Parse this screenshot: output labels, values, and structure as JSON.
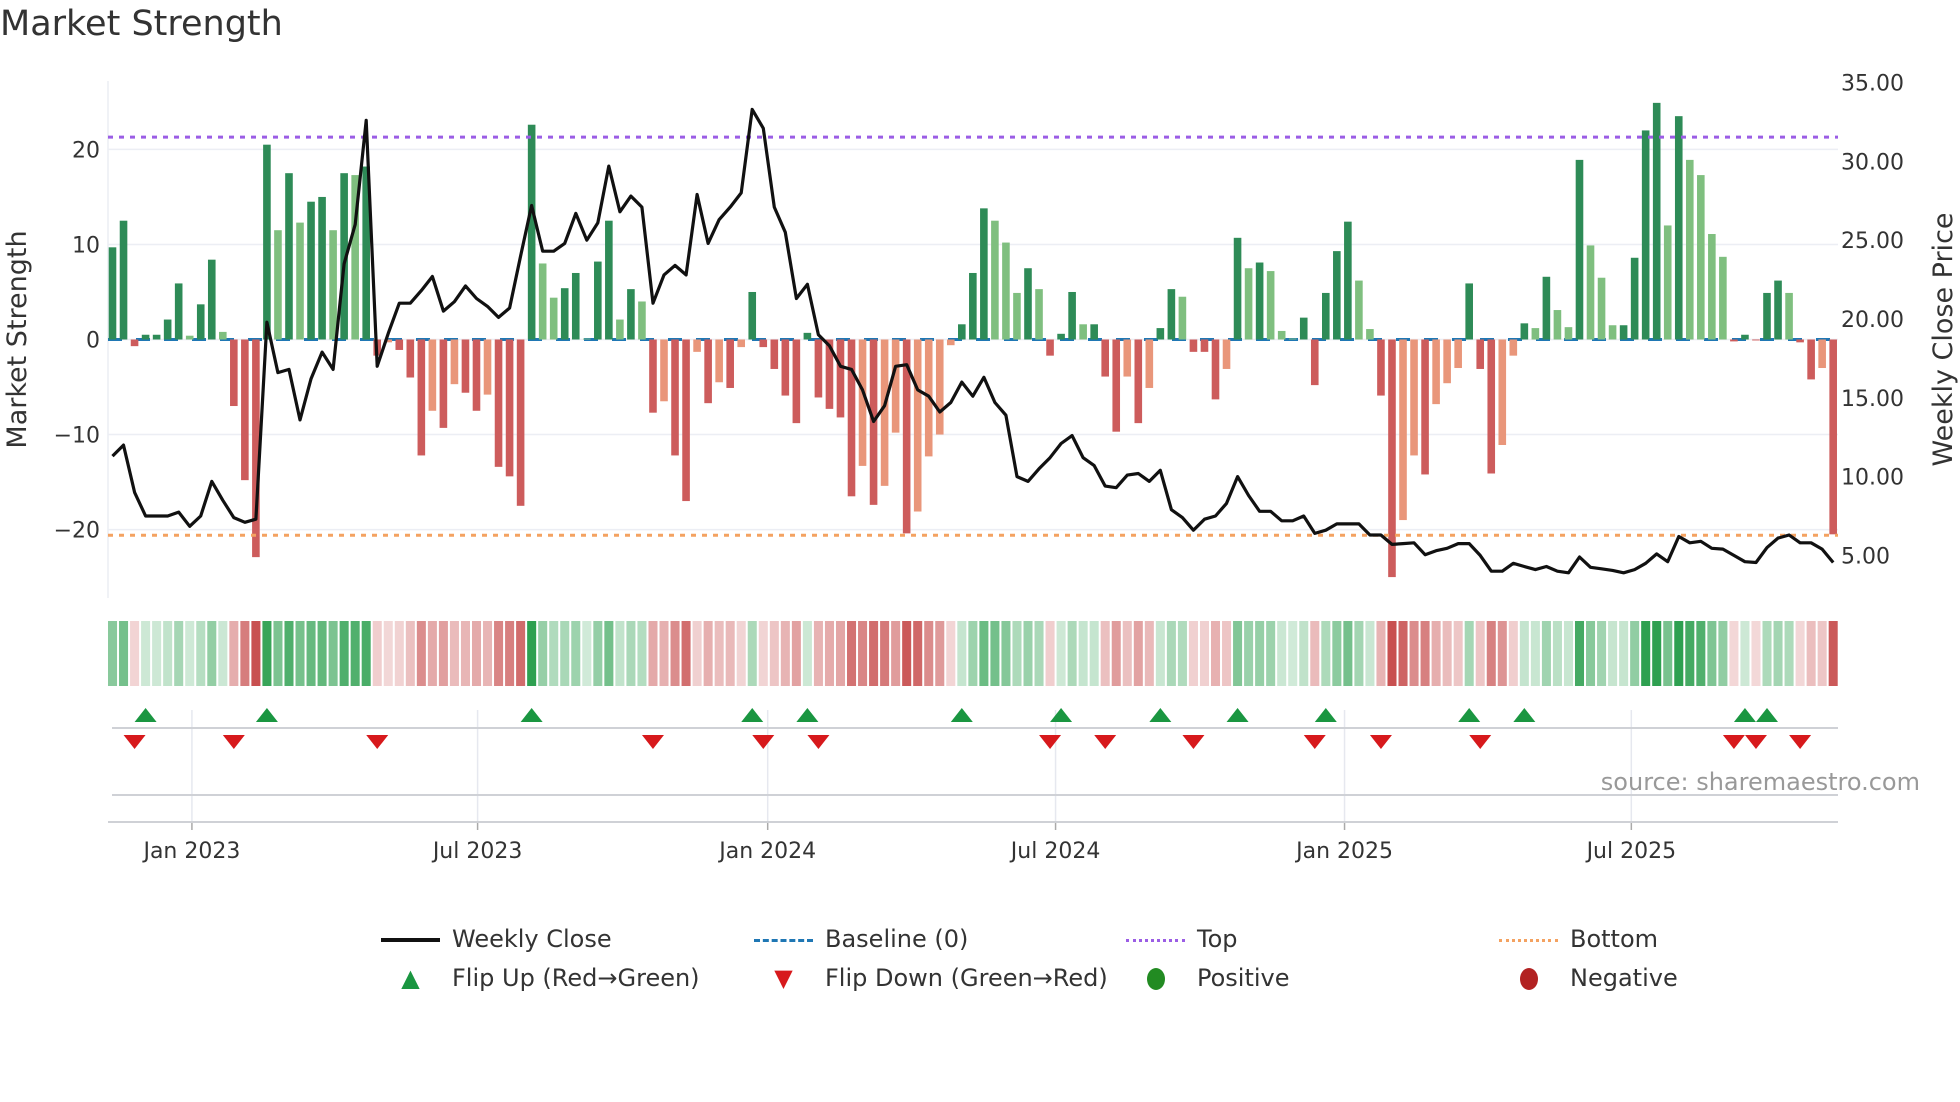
{
  "title": "Market Strength",
  "source": "source: sharemaestro.com",
  "colors": {
    "dark_green": "#2e8b57",
    "light_green": "#7fbf7f",
    "dark_red": "#cd5c5c",
    "light_red": "#e9967a",
    "baseline": "#1f77b4",
    "top": "#9b5de5",
    "bottom": "#f4a261",
    "flip_up": "#1a9641",
    "flip_down": "#d7191c",
    "positive": "#228b22",
    "negative": "#b22222",
    "price": "#111111"
  },
  "legend": [
    {
      "label": "Weekly Close",
      "icon": "solid-line"
    },
    {
      "label": "Baseline (0)",
      "icon": "dashed-line"
    },
    {
      "label": "Top",
      "icon": "dotted-line"
    },
    {
      "label": "Bottom",
      "icon": "dotted-line"
    },
    {
      "label": "Flip Up (Red→Green)",
      "icon": "triangle-up"
    },
    {
      "label": "Flip Down (Green→Red)",
      "icon": "triangle-down"
    },
    {
      "label": "Positive",
      "icon": "circle"
    },
    {
      "label": "Negative",
      "icon": "circle"
    }
  ],
  "chart_data": {
    "type": "bar",
    "title": "Market Strength",
    "ylabel": "Market Strength",
    "y2label": "Weekly Close Price",
    "ylim": [
      -27.2,
      27.2
    ],
    "y2lim": [
      2.3,
      35.1
    ],
    "yticks": [
      20,
      10,
      0,
      -10,
      -20
    ],
    "ytick_labels": [
      "20",
      "10",
      "0",
      "−10",
      "−20"
    ],
    "y2ticks": [
      35,
      30,
      25,
      20,
      15,
      10,
      5
    ],
    "y2tick_labels": [
      "35.00",
      "30.00",
      "25.00",
      "20.00",
      "15.00",
      "10.00",
      "5.00"
    ],
    "xticks": [
      {
        "label": "Jan 2023",
        "week": 7.2
      },
      {
        "label": "Jul 2023",
        "week": 33.1
      },
      {
        "label": "Jan 2024",
        "week": 59.4
      },
      {
        "label": "Jul 2024",
        "week": 85.5
      },
      {
        "label": "Jan 2025",
        "week": 111.7
      },
      {
        "label": "Jul 2025",
        "week": 137.7
      }
    ],
    "top_level": 21.3,
    "bottom_level": -20.6,
    "strength": [
      9.7,
      12.5,
      -0.7,
      0.5,
      0.5,
      2.1,
      5.9,
      0.4,
      3.7,
      8.4,
      0.8,
      -7.0,
      -14.8,
      -22.9,
      20.5,
      11.5,
      17.5,
      12.3,
      14.5,
      15.0,
      11.5,
      17.5,
      17.3,
      18.2,
      -1.7,
      -0.3,
      -1.1,
      -4.0,
      -12.2,
      -7.5,
      -9.3,
      -4.7,
      -5.6,
      -7.5,
      -5.8,
      -13.4,
      -14.4,
      -17.5,
      22.6,
      8.0,
      4.4,
      5.4,
      7.0,
      0.1,
      8.2,
      12.5,
      2.1,
      5.3,
      4.0,
      -7.7,
      -6.5,
      -12.2,
      -17.0,
      -1.3,
      -6.7,
      -4.5,
      -5.1,
      -0.8,
      5.0,
      -0.8,
      -3.1,
      -5.9,
      -8.8,
      0.7,
      -6.1,
      -7.3,
      -8.2,
      -16.5,
      -13.3,
      -17.4,
      -15.4,
      -9.8,
      -20.4,
      -18.1,
      -12.3,
      -10.0,
      -0.6,
      1.6,
      7.0,
      13.8,
      12.5,
      10.2,
      4.9,
      7.5,
      5.3,
      -1.7,
      0.6,
      5.0,
      1.6,
      1.6,
      -3.9,
      -9.7,
      -3.9,
      -8.8,
      -5.1,
      1.2,
      5.3,
      4.5,
      -1.3,
      -1.3,
      -6.3,
      -3.1,
      10.7,
      7.5,
      8.1,
      7.2,
      0.9,
      0.1,
      2.3,
      -4.8,
      4.9,
      9.3,
      12.4,
      6.2,
      1.1,
      -5.9,
      -25.0,
      -19.0,
      -12.2,
      -14.2,
      -6.8,
      -4.6,
      -3.0,
      5.9,
      -3.1,
      -14.1,
      -11.1,
      -1.7,
      1.7,
      1.2,
      6.6,
      3.1,
      1.3,
      18.9,
      9.9,
      6.5,
      1.5,
      1.5,
      8.6,
      22.0,
      24.9,
      12.0,
      23.5,
      18.9,
      17.3,
      11.1,
      8.7,
      -0.2,
      0.5,
      -0.1,
      4.9,
      6.2,
      4.9,
      -0.3,
      -4.2,
      -3.0,
      -20.5
    ],
    "weekly_close": [
      11.3,
      12.0,
      9.0,
      7.5,
      7.5,
      7.5,
      7.75,
      6.85,
      7.5,
      9.7,
      8.5,
      7.4,
      7.1,
      7.3,
      19.8,
      16.6,
      16.8,
      13.6,
      16.2,
      17.9,
      16.8,
      23.5,
      26.0,
      32.6,
      17.0,
      19.1,
      21.0,
      21.0,
      21.8,
      22.7,
      20.5,
      21.1,
      22.1,
      21.3,
      20.8,
      20.1,
      20.7,
      24.0,
      27.2,
      24.3,
      24.3,
      24.8,
      26.7,
      25.0,
      26.1,
      29.7,
      26.8,
      27.8,
      27.1,
      21.0,
      22.8,
      23.4,
      22.8,
      27.9,
      24.8,
      26.3,
      27.1,
      28.0,
      33.3,
      32.1,
      27.1,
      25.5,
      21.3,
      22.2,
      19.0,
      18.3,
      17.0,
      16.8,
      15.5,
      13.5,
      14.5,
      17.0,
      17.1,
      15.5,
      15.1,
      14.1,
      14.7,
      16.0,
      15.1,
      16.3,
      14.7,
      13.9,
      10.0,
      9.7,
      10.5,
      11.2,
      12.1,
      12.6,
      11.2,
      10.7,
      9.4,
      9.3,
      10.1,
      10.2,
      9.7,
      10.4,
      7.9,
      7.4,
      6.6,
      7.3,
      7.5,
      8.3,
      10.0,
      8.8,
      7.8,
      7.8,
      7.2,
      7.2,
      7.5,
      6.4,
      6.6,
      7.0,
      7.0,
      7.0,
      6.3,
      6.3,
      5.7,
      5.75,
      5.8,
      5.05,
      5.3,
      5.45,
      5.75,
      5.75,
      5.0,
      4.0,
      4.0,
      4.5,
      4.3,
      4.1,
      4.3,
      4.0,
      3.9,
      4.9,
      4.25,
      4.15,
      4.05,
      3.9,
      4.1,
      4.5,
      5.1,
      4.6,
      6.2,
      5.8,
      5.9,
      5.45,
      5.4,
      5.0,
      4.6,
      4.55,
      5.5,
      6.1,
      6.3,
      5.8,
      5.8,
      5.4,
      4.55
    ],
    "flip_up_weeks": [
      3,
      14,
      38,
      58,
      63,
      77,
      86,
      95,
      102,
      110,
      123,
      128,
      148,
      150
    ],
    "flip_down_weeks": [
      2,
      11,
      24,
      49,
      59,
      64,
      85,
      90,
      98,
      109,
      115,
      124,
      147,
      149,
      153
    ]
  }
}
